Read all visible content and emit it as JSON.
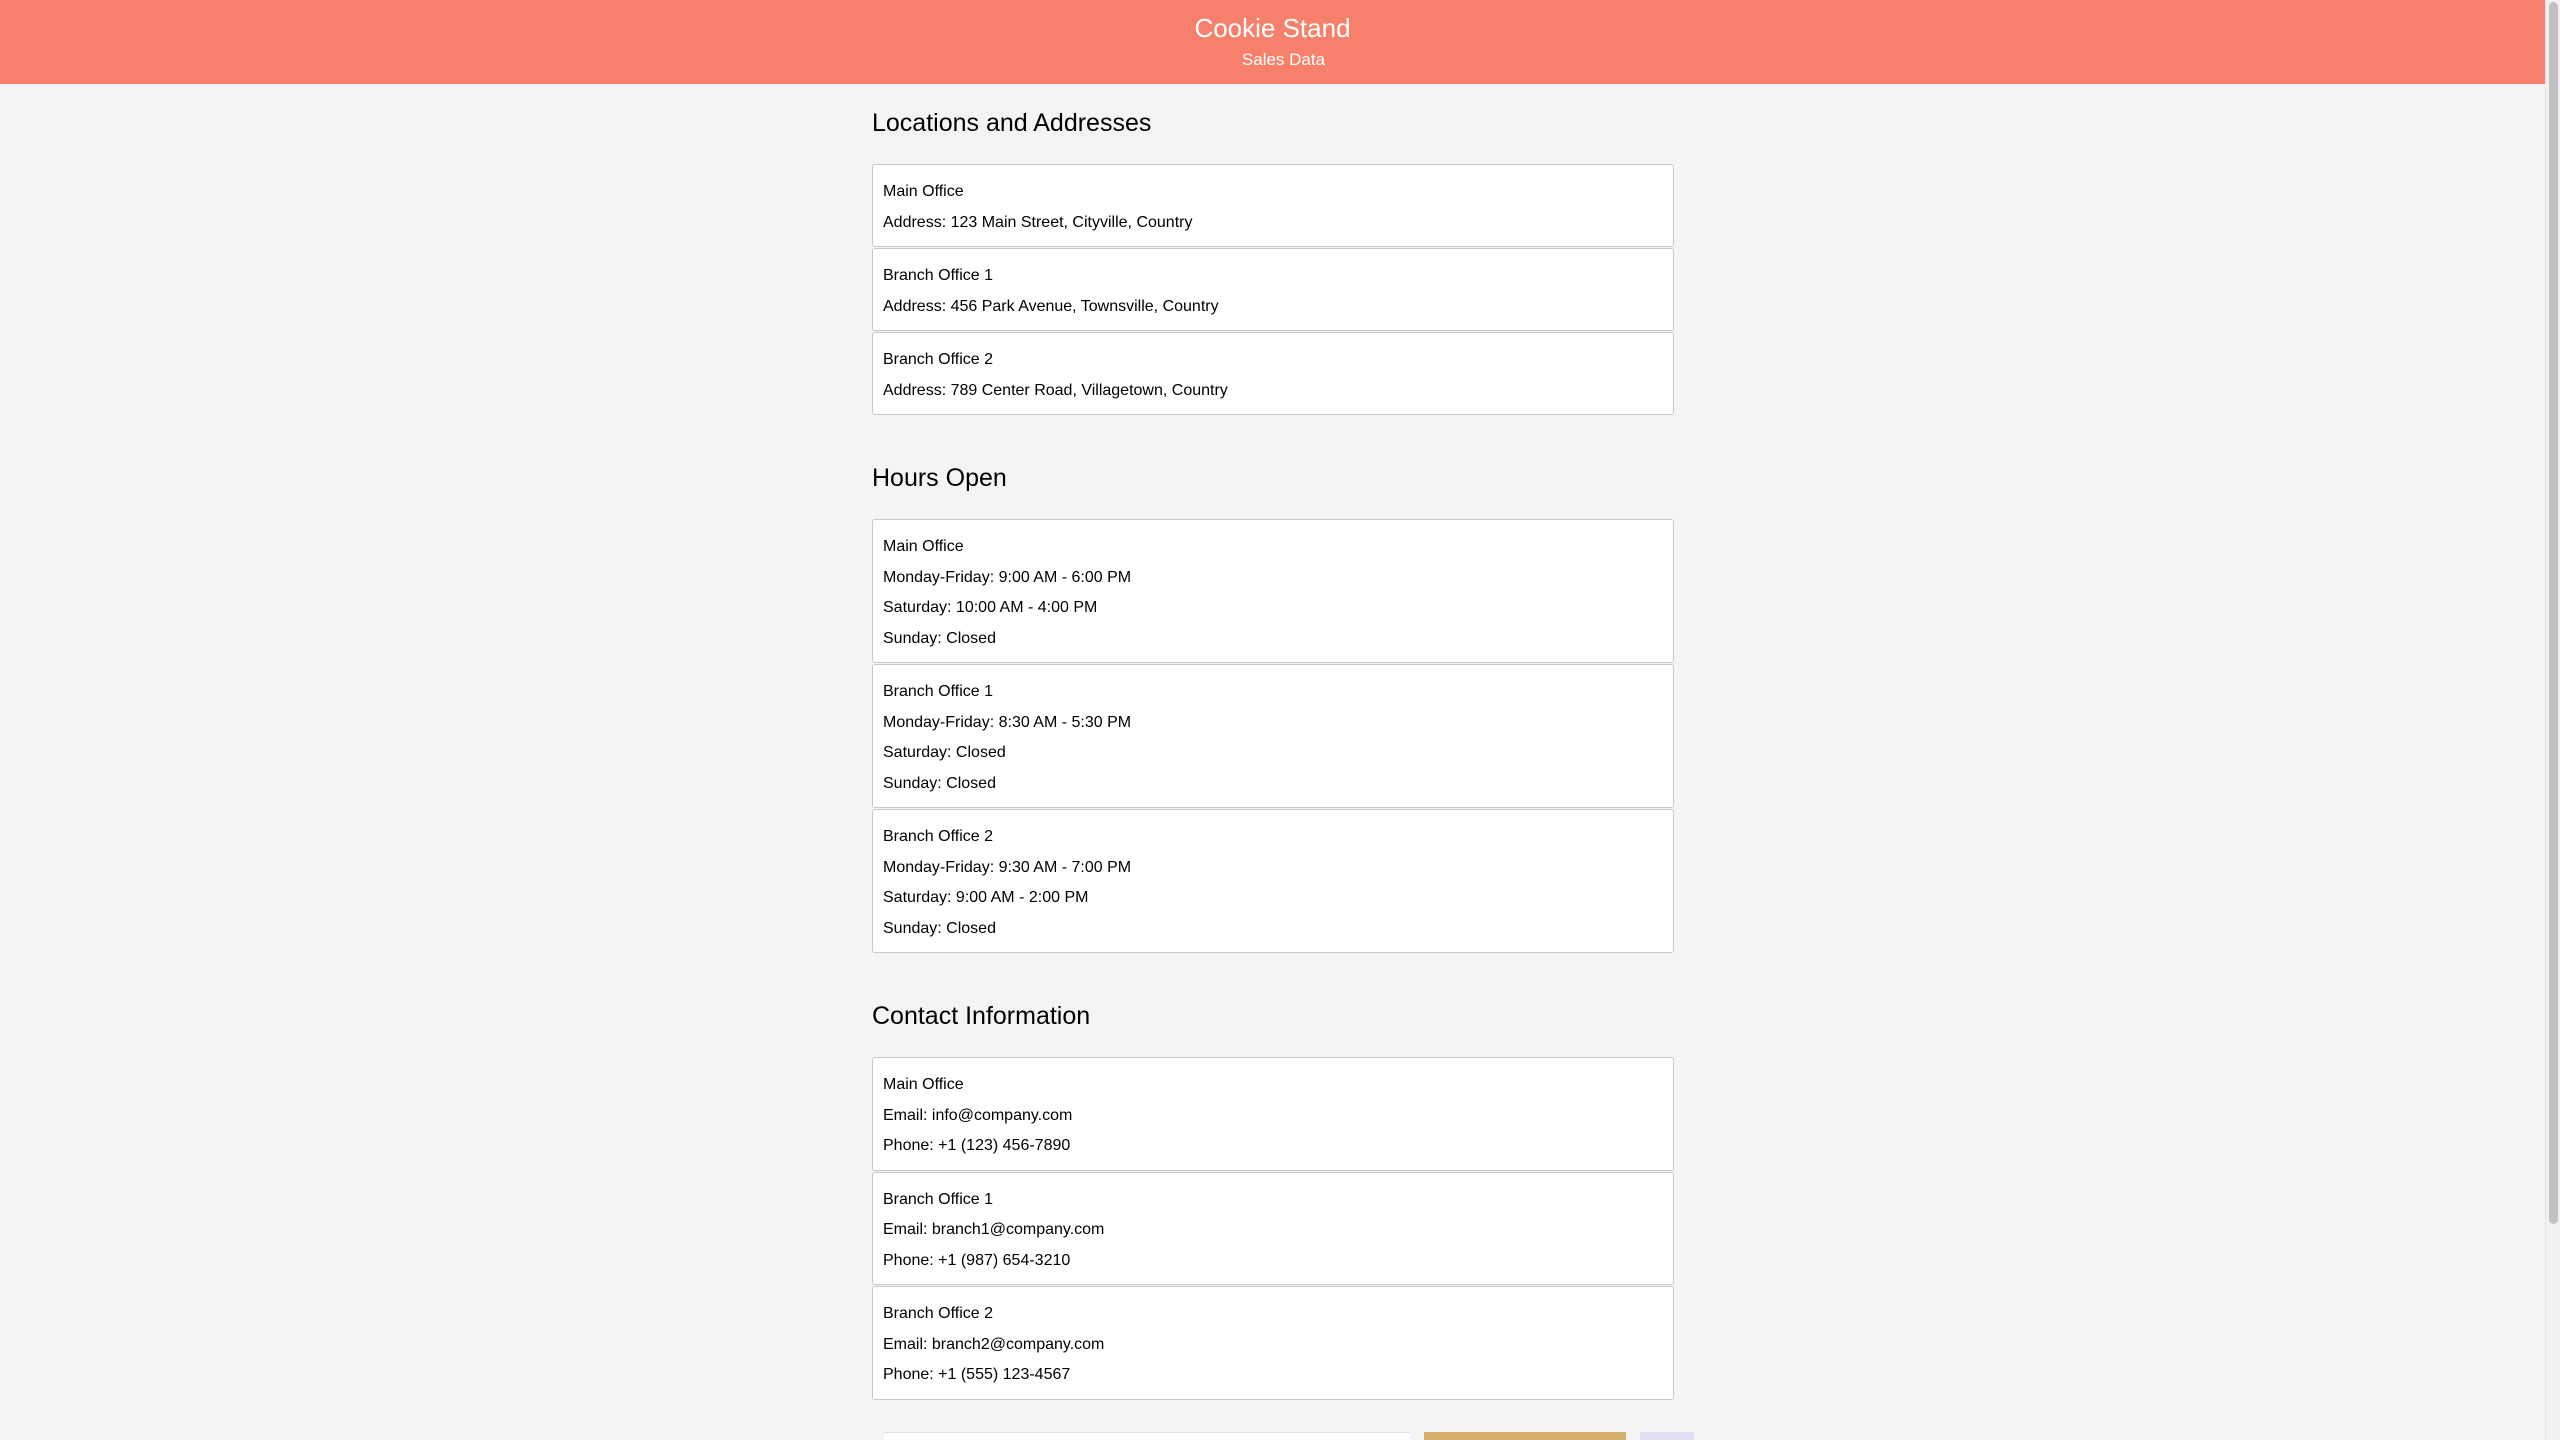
{
  "header": {
    "title": "Cookie Stand",
    "subtitle": "Sales Data"
  },
  "sections": [
    {
      "title": "Locations and Addresses",
      "cards": [
        {
          "lines": [
            "Main Office",
            "Address: 123 Main Street, Cityville, Country"
          ]
        },
        {
          "lines": [
            "Branch Office 1",
            "Address: 456 Park Avenue, Townsville, Country"
          ]
        },
        {
          "lines": [
            "Branch Office 2",
            "Address: 789 Center Road, Villagetown, Country"
          ]
        }
      ]
    },
    {
      "title": "Hours Open",
      "cards": [
        {
          "lines": [
            "Main Office",
            "Monday-Friday: 9:00 AM - 6:00 PM",
            "Saturday: 10:00 AM - 4:00 PM",
            "Sunday: Closed"
          ]
        },
        {
          "lines": [
            "Branch Office 1",
            "Monday-Friday: 8:30 AM - 5:30 PM",
            "Saturday: Closed",
            "Sunday: Closed"
          ]
        },
        {
          "lines": [
            "Branch Office 2",
            "Monday-Friday: 9:30 AM - 7:00 PM",
            "Saturday: 9:00 AM - 2:00 PM",
            "Sunday: Closed"
          ]
        }
      ]
    },
    {
      "title": "Contact Information",
      "cards": [
        {
          "lines": [
            "Main Office",
            "Email: info@company.com",
            "Phone: +1 (123) 456-7890"
          ]
        },
        {
          "lines": [
            "Branch Office 1",
            "Email: branch1@company.com",
            "Phone: +1 (987) 654-3210"
          ]
        },
        {
          "lines": [
            "Branch Office 2",
            "Email: branch2@company.com",
            "Phone: +1 (555) 123-4567"
          ]
        }
      ]
    }
  ],
  "colors": {
    "header_bg": "#f6806c",
    "page_bg": "#f4f4f4",
    "card_bg": "#ffffff",
    "card_border": "#c8c8c8"
  }
}
